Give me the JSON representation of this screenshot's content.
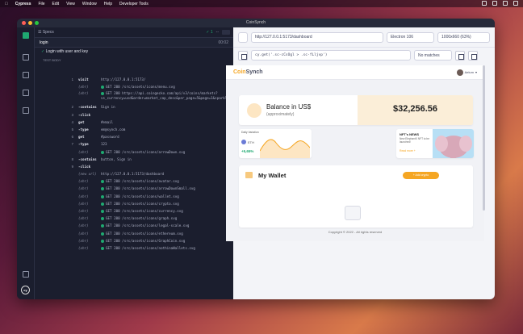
{
  "menubar": {
    "app": "Cypress",
    "items": [
      "File",
      "Edit",
      "View",
      "Window",
      "Help",
      "Developer Tools"
    ]
  },
  "window": {
    "title": "CoinSynch"
  },
  "specs": {
    "label": "Specs",
    "passed": "1",
    "pending": "--"
  },
  "test": {
    "name": "login",
    "duration": "00:02",
    "title": "Login with user and key",
    "body_label": "TEST BODY"
  },
  "commands": [
    {
      "n": "1",
      "name": "visit",
      "msg": "http://127.0.0.1:5173/",
      "type": "plain"
    },
    {
      "n": "",
      "name": "(xhr)",
      "msg": "GET 200 /src/assets/icons/menu.svg",
      "type": "xhr"
    },
    {
      "n": "",
      "name": "(xhr)",
      "msg": "GET 200 https://api.coingecko.com/api/v3/coins/markets?vs_currency=usd&order=market_cap_desc&per_page=5&page=1&sparkline=false",
      "type": "xhr-wrap"
    },
    {
      "n": "2",
      "name": "-contains",
      "msg": "Sign in",
      "type": "plain"
    },
    {
      "n": "3",
      "name": "-click",
      "msg": "",
      "type": "plain"
    },
    {
      "n": "4",
      "name": "get",
      "msg": "#email",
      "type": "plain"
    },
    {
      "n": "5",
      "name": "-type",
      "msg": "em@synch.com",
      "type": "plain"
    },
    {
      "n": "6",
      "name": "get",
      "msg": "#password",
      "type": "plain"
    },
    {
      "n": "7",
      "name": "-type",
      "msg": "123",
      "type": "plain"
    },
    {
      "n": "",
      "name": "(xhr)",
      "msg": "GET 200 /src/assets/icons/arrowDown.svg",
      "type": "xhr"
    },
    {
      "n": "8",
      "name": "-contains",
      "msg": "button, Sign in",
      "type": "plain"
    },
    {
      "n": "9",
      "name": "-click",
      "msg": "",
      "type": "plain"
    },
    {
      "n": "",
      "name": "(new url)",
      "msg": "http://127.0.0.1:5173/dashboard",
      "type": "newurl"
    },
    {
      "n": "",
      "name": "(xhr)",
      "msg": "GET 200 /src/assets/icons/avatar.svg",
      "type": "xhr"
    },
    {
      "n": "",
      "name": "(xhr)",
      "msg": "GET 200 /src/assets/icons/arrowDownSmall.svg",
      "type": "xhr"
    },
    {
      "n": "",
      "name": "(xhr)",
      "msg": "GET 200 /src/assets/icons/wallet.svg",
      "type": "xhr"
    },
    {
      "n": "",
      "name": "(xhr)",
      "msg": "GET 200 /src/assets/icons/crypto.svg",
      "type": "xhr"
    },
    {
      "n": "",
      "name": "(xhr)",
      "msg": "GET 200 /src/assets/icons/currency.svg",
      "type": "xhr"
    },
    {
      "n": "",
      "name": "(xhr)",
      "msg": "GET 200 /src/assets/icons/graph.svg",
      "type": "xhr"
    },
    {
      "n": "",
      "name": "(xhr)",
      "msg": "GET 200 /src/assets/icons/legal-scale.svg",
      "type": "xhr"
    },
    {
      "n": "",
      "name": "(xhr)",
      "msg": "GET 200 /src/assets/icons/ethereum.svg",
      "type": "xhr"
    },
    {
      "n": "",
      "name": "(xhr)",
      "msg": "GET 200 /src/assets/icons/GraphCoin.svg",
      "type": "xhr"
    },
    {
      "n": "",
      "name": "(xhr)",
      "msg": "GET 200 /src/assets/icons/nothinaWallets.svg",
      "type": "xhr"
    }
  ],
  "aut": {
    "url": "http://127.0.0.1:5173/dashboard",
    "browser": "Electron 106",
    "viewport": "1000x660 (63%)",
    "selector": "cy.get('.sc-cCsOgl > .sc-fLljvp')",
    "matches": "No matches"
  },
  "app": {
    "logo_a": "Coin",
    "logo_b": "Synch",
    "user": "Aelum",
    "balance_title": "Balance in US$",
    "balance_sub": "(approximately)",
    "balance_amount": "$32,256.56",
    "daily_title": "Daily Variation",
    "daily_coin": "ETH",
    "daily_pct": "+5,65%",
    "nft_title": "NFT's NEWS",
    "nft_desc": "New ElephantX NFT to be launched!",
    "nft_read": "Read more +",
    "wallet_title": "My Wallet",
    "add_crypto": "+ Add crypto",
    "copyright": "Copyright © 2022 - All rights reserved"
  }
}
